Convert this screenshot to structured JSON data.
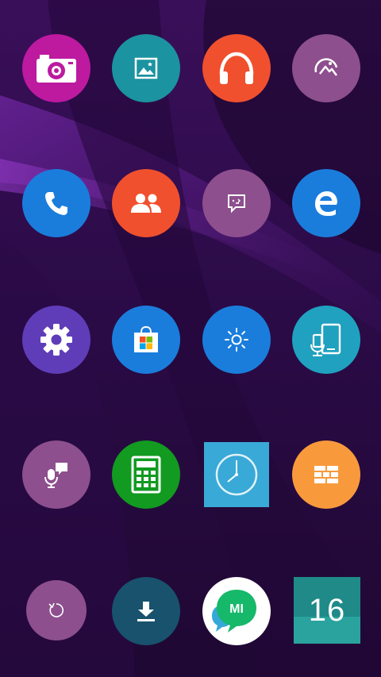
{
  "screen": {
    "name": "home-screen"
  },
  "colors": {
    "camera": "#bd1aa0",
    "photos": "#1b93a0",
    "music": "#f0502d",
    "gallery": "#8d4f8e",
    "phone": "#1a7ddc",
    "contacts": "#f0502d",
    "messages": "#8d4f8e",
    "browser": "#1a7ddc",
    "settings": "#5f3db8",
    "store": "#1a7ddc",
    "display": "#1a7ddc",
    "devices": "#1fa1bf",
    "recorder": "#8d4f8e",
    "calculator": "#129a21",
    "clock": "#39a9d7",
    "sim": "#f89a3c",
    "update": "#8d4f8e",
    "downloads": "#18526d",
    "mi_talk": "#ffffff",
    "calendar": "#1f8a88"
  },
  "apps": [
    {
      "id": "camera",
      "icon": "camera-icon"
    },
    {
      "id": "photos",
      "icon": "image-icon"
    },
    {
      "id": "music",
      "icon": "headphones-icon"
    },
    {
      "id": "gallery",
      "icon": "landscape-icon"
    },
    {
      "id": "phone",
      "icon": "phone-icon"
    },
    {
      "id": "contacts",
      "icon": "people-icon"
    },
    {
      "id": "messages",
      "icon": "chat-icon"
    },
    {
      "id": "browser",
      "icon": "edge-icon"
    },
    {
      "id": "settings",
      "icon": "gear-icon"
    },
    {
      "id": "store",
      "icon": "store-icon"
    },
    {
      "id": "display",
      "icon": "brightness-icon"
    },
    {
      "id": "devices",
      "icon": "devices-icon"
    },
    {
      "id": "recorder",
      "icon": "voice-icon"
    },
    {
      "id": "calculator",
      "icon": "calculator-icon"
    },
    {
      "id": "clock",
      "icon": "clock-icon"
    },
    {
      "id": "sim",
      "icon": "sim-icon"
    },
    {
      "id": "update",
      "icon": "refresh-icon"
    },
    {
      "id": "downloads",
      "icon": "download-icon"
    },
    {
      "id": "mi_talk",
      "icon": "mi-talk-icon",
      "badge_text": "MI"
    },
    {
      "id": "calendar",
      "icon": "calendar-icon"
    }
  ],
  "calendar": {
    "day": "16"
  }
}
